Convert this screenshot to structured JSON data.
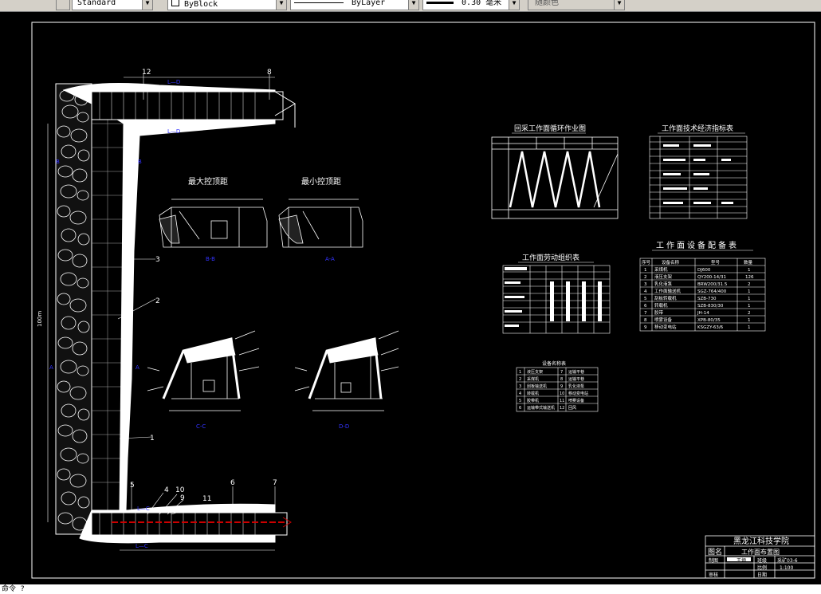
{
  "toolbar": {
    "textstyle": "Standard",
    "layer": "ByBlock",
    "linetype": "ByLayer",
    "lineweight": "0.30 毫米",
    "color": "随颜色"
  },
  "drawing": {
    "sections": {
      "max_support": "最大控顶距",
      "min_support": "最小控顶距",
      "bb": "B-B",
      "aa": "A-A",
      "cc": "C-C",
      "dd": "D-D"
    },
    "labels": {
      "n1": "1",
      "n2": "2",
      "n3": "3",
      "n4": "4",
      "n5": "5",
      "n6": "6",
      "n7": "7",
      "n8": "8",
      "n9": "9",
      "n10": "10",
      "n11": "11",
      "n12": "12",
      "len": "100m"
    },
    "tables": {
      "cycle": "回采工作面循环作业图",
      "tech": "工作面技术经济指标表",
      "labor": "工作面劳动组织表",
      "equip": "工作面设备配备表",
      "legend": "设备名称表"
    },
    "equip_rows": [
      {
        "no": "1",
        "name": "采煤机",
        "model": "DJ600",
        "qty": "1"
      },
      {
        "no": "2",
        "name": "液压支架",
        "model": "QY200-14/31",
        "qty": "126"
      },
      {
        "no": "3",
        "name": "乳化液泵",
        "model": "BRW200/31.5",
        "qty": "2"
      },
      {
        "no": "4",
        "name": "工作面输送机",
        "model": "SGZ-764/400",
        "qty": "1"
      },
      {
        "no": "5",
        "name": "刮板转载机",
        "model": "SZB-730",
        "qty": "1"
      },
      {
        "no": "6",
        "name": "转载机",
        "model": "SZB-830/30",
        "qty": "1"
      },
      {
        "no": "7",
        "name": "胶带",
        "model": "JH-14",
        "qty": "2"
      },
      {
        "no": "8",
        "name": "喷雾设备",
        "model": "XPB-80/35",
        "qty": "1"
      },
      {
        "no": "9",
        "name": "移动变电站",
        "model": "KSGZY-63/6",
        "qty": "1"
      }
    ],
    "equip_head": {
      "no": "序号",
      "name": "设备名称",
      "model": "型号",
      "qty": "数量"
    },
    "legend_rows": [
      {
        "a": "1",
        "b": "液压支架",
        "c": "7",
        "d": "运输平巷"
      },
      {
        "a": "2",
        "b": "采煤机",
        "c": "8",
        "d": "运输平巷"
      },
      {
        "a": "3",
        "b": "刮板输送机",
        "c": "9",
        "d": "乳化液泵"
      },
      {
        "a": "4",
        "b": "转载机",
        "c": "10",
        "d": "移动变电站"
      },
      {
        "a": "5",
        "b": "胶带机",
        "c": "11",
        "d": "喷雾设备"
      },
      {
        "a": "6",
        "b": "运输带式输送机",
        "c": "12",
        "d": "回风"
      }
    ],
    "title_block": {
      "school": "黑龙江科技学院",
      "label": "图名",
      "title": "工作面布置图",
      "drawn": "制图",
      "designer": "王炳",
      "class": "班级",
      "class_val": "采矿03-6",
      "check": "审核",
      "scale": "比例",
      "scale_val": "1:100",
      "date": "日期"
    }
  },
  "commandline": {
    "text": "命令 ?"
  }
}
